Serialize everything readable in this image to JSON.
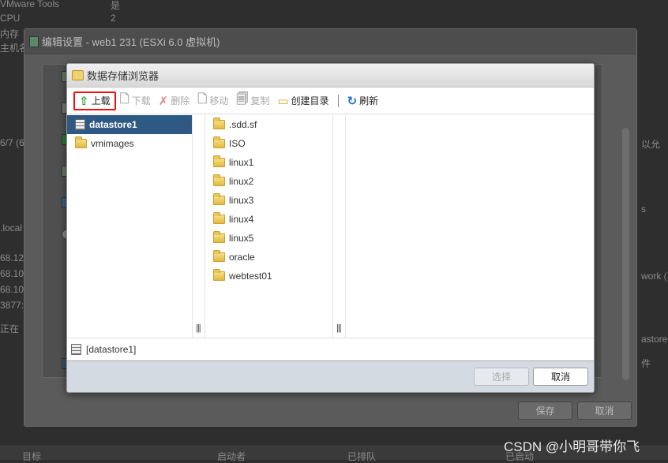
{
  "background": {
    "props": [
      {
        "label": "VMware Tools",
        "value": "是"
      },
      {
        "label": "CPU",
        "value": "2"
      },
      {
        "label": "内存",
        "value": ""
      },
      {
        "label": "主机名",
        "value": ""
      }
    ],
    "left_fragments": [
      "6/7 (6",
      ".local",
      "68.12",
      "68.10",
      "68.10",
      "3877:",
      "正在"
    ],
    "right_fragments": [
      "以允",
      "s",
      "work (已",
      "astore",
      "件"
    ],
    "task_columns": [
      "目标",
      "启动者",
      "已排队",
      "已启动"
    ]
  },
  "edit_dialog": {
    "title": "编辑设置 - web1 231 (ESXi 6.0 虚拟机)",
    "save_label": "保存",
    "cancel_label": "取消"
  },
  "browser": {
    "title": "数据存储浏览器",
    "toolbar": [
      {
        "label": "上载",
        "icon": "upload-arrow-icon",
        "enabled": true,
        "highlighted": true
      },
      {
        "label": "下载",
        "icon": "download-icon",
        "enabled": false
      },
      {
        "label": "删除",
        "icon": "delete-icon",
        "enabled": false
      },
      {
        "label": "移动",
        "icon": "move-icon",
        "enabled": false
      },
      {
        "label": "复制",
        "icon": "copy-icon",
        "enabled": false
      },
      {
        "label": "创建目录",
        "icon": "new-folder-icon",
        "enabled": true
      },
      {
        "label": "刷新",
        "icon": "refresh-icon",
        "enabled": true
      }
    ],
    "datastores": [
      {
        "name": "datastore1",
        "selected": true
      },
      {
        "name": "vmimages",
        "selected": false
      }
    ],
    "folders": [
      ".sdd.sf",
      "ISO",
      "linux1",
      "linux2",
      "linux3",
      "linux4",
      "linux5",
      "oracle",
      "webtest01"
    ],
    "status_path": "[datastore1]",
    "select_label": "选择",
    "cancel_label": "取消"
  },
  "watermark": "CSDN @小明哥带你飞",
  "colors": {
    "selection": "#2e5984",
    "highlight_border": "#ee1111",
    "footer": "#d3dae2"
  }
}
